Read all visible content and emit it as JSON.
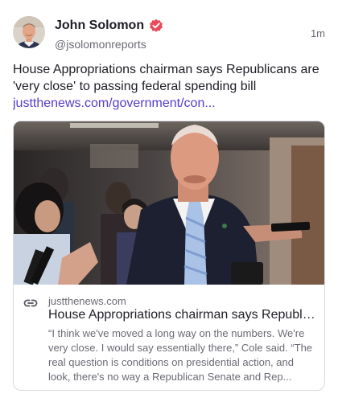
{
  "post": {
    "author_name": "John Solomon",
    "author_handle": "@jsolomonreports",
    "timestamp": "1m",
    "body_text": "House Appropriations chairman says Republicans are 'very close' to passing federal spending bill",
    "link_text": "justthenews.com/government/con...",
    "verified_icon": "verified-badge-icon",
    "colors": {
      "accent": "#563acc",
      "badge": "#e94a5a",
      "text": "#1f1d26",
      "muted": "#6b6a75"
    }
  },
  "card": {
    "domain": "justthenews.com",
    "title": "House Appropriations chairman says Republic...",
    "description": "“I think we've moved a long way on the numbers. We're very close. I would say essentially there,” Cole said. “The real question is conditions on presidential action, and look, there's no way a Republican Senate and Rep..."
  }
}
